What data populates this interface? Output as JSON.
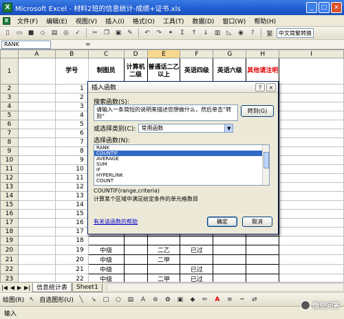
{
  "window": {
    "title": "Microsoft Excel - 材料2班的信息统计-成绩+证书.xls",
    "min": "_",
    "max": "□",
    "close": "×"
  },
  "menu": [
    "文件(F)",
    "编辑(E)",
    "视图(V)",
    "插入(I)",
    "格式(O)",
    "工具(T)",
    "数据(D)",
    "窗口(W)",
    "帮助(H)"
  ],
  "toolbar": {
    "font_convert": "中文简繁转换",
    "sigma": "Σ"
  },
  "formula_bar": {
    "name_box": "RANK",
    "fx": "="
  },
  "columns": [
    "A",
    "B",
    "C",
    "D",
    "E",
    "F",
    "G",
    "H",
    "I"
  ],
  "header_row": {
    "row_num": "1",
    "b": "学号",
    "c": "制图员",
    "d": "计算机二级",
    "e": "普通话二乙以上",
    "f": "英语四级",
    "g": "英语六级",
    "h": "其他请注明"
  },
  "rows": [
    {
      "n": "2",
      "b": "1",
      "c": "",
      "e": "",
      "f": ""
    },
    {
      "n": "3",
      "b": "2",
      "c": "",
      "e": "",
      "f": ""
    },
    {
      "n": "4",
      "b": "3",
      "c": "",
      "e": "",
      "f": ""
    },
    {
      "n": "5",
      "b": "4",
      "c": "",
      "e": "",
      "f": ""
    },
    {
      "n": "6",
      "b": "5",
      "c": "",
      "e": "",
      "f": ""
    },
    {
      "n": "7",
      "b": "6",
      "c": "",
      "e": "",
      "f": ""
    },
    {
      "n": "8",
      "b": "7",
      "c": "",
      "e": "",
      "f": ""
    },
    {
      "n": "9",
      "b": "8",
      "c": "",
      "e": "",
      "f": ""
    },
    {
      "n": "10",
      "b": "9",
      "c": "",
      "e": "",
      "f": ""
    },
    {
      "n": "11",
      "b": "10",
      "c": "",
      "e": "",
      "f": ""
    },
    {
      "n": "12",
      "b": "11",
      "c": "",
      "e": "",
      "f": ""
    },
    {
      "n": "13",
      "b": "12",
      "c": "",
      "e": "",
      "f": ""
    },
    {
      "n": "14",
      "b": "13",
      "c": "",
      "e": "",
      "f": ""
    },
    {
      "n": "15",
      "b": "14",
      "c": "",
      "e": "",
      "f": ""
    },
    {
      "n": "16",
      "b": "15",
      "c": "",
      "e": "",
      "f": ""
    },
    {
      "n": "17",
      "b": "16",
      "c": "",
      "e": "",
      "f": ""
    },
    {
      "n": "18",
      "b": "17",
      "c": "",
      "e": "",
      "f": ""
    },
    {
      "n": "19",
      "b": "18",
      "c": "",
      "e": "",
      "f": ""
    },
    {
      "n": "20",
      "b": "19",
      "c": "中级",
      "e": "二乙",
      "f": "已过"
    },
    {
      "n": "21",
      "b": "20",
      "c": "中级",
      "e": "二甲",
      "f": ""
    },
    {
      "n": "22",
      "b": "21",
      "c": "中级",
      "e": "",
      "f": "已过"
    },
    {
      "n": "23",
      "b": "22",
      "c": "中级",
      "e": "二甲",
      "f": "已过"
    },
    {
      "n": "24",
      "b": "",
      "c": "20",
      "e": "=",
      "f": ""
    }
  ],
  "dialog": {
    "title": "插入函数",
    "help": "?",
    "close": "×",
    "search_label": "搜索函数(S):",
    "search_text": "请输入一条简短的说明来描述您想做什么，然后单击“转到”",
    "goto": "转到(G)",
    "category_label": "或选择类别(C):",
    "category_value": "常用函数",
    "list_label": "选择函数(N):",
    "functions": [
      "RANK",
      "COUNTIF",
      "AVERAGE",
      "SUM",
      "IF",
      "HYPERLINK",
      "COUNT"
    ],
    "selected_function": "COUNTIF",
    "signature": "COUNTIF(range,criteria)",
    "description": "计算某个区域中满足给定条件的单元格数目",
    "help_link": "有关该函数的帮助",
    "ok": "确定",
    "cancel": "取消"
  },
  "sheet_tabs": [
    "信息统计表",
    "Sheet1"
  ],
  "drawing": {
    "draw": "绘图(R)",
    "autoshape": "自选图形(U)"
  },
  "status": "输入",
  "watermark": "悟空问答"
}
